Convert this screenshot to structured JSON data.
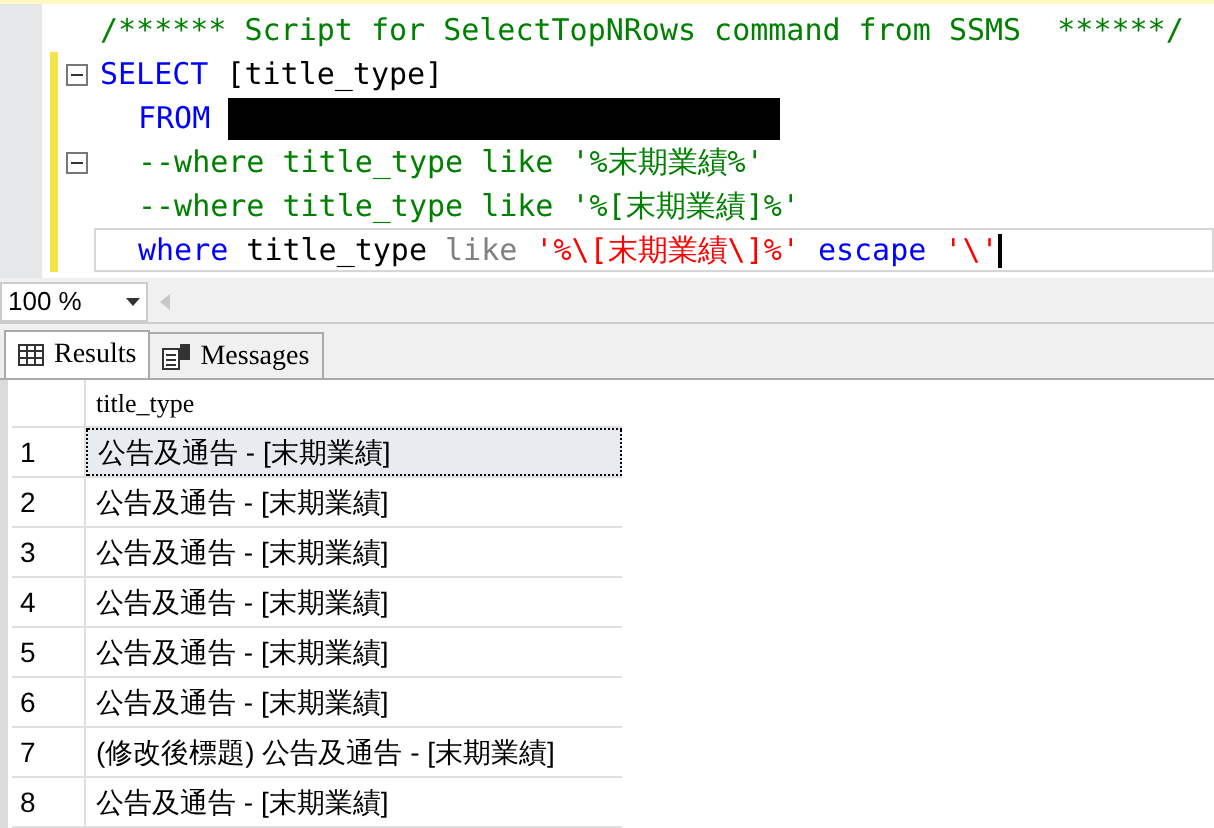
{
  "editor": {
    "lines": [
      {
        "indented": false,
        "foldable": false,
        "current": false,
        "tokens": [
          {
            "kind": "comment",
            "text": "/****** Script for SelectTopNRows command from SSMS  ******/"
          }
        ]
      },
      {
        "indented": false,
        "foldable": true,
        "current": false,
        "tokens": [
          {
            "kind": "keyword",
            "text": "SELECT"
          },
          {
            "kind": "plain",
            "text": " [title_type]"
          }
        ]
      },
      {
        "indented": true,
        "foldable": false,
        "current": false,
        "tokens": [
          {
            "kind": "keyword",
            "text": "FROM"
          },
          {
            "kind": "redacted"
          }
        ]
      },
      {
        "indented": true,
        "foldable": true,
        "current": false,
        "tokens": [
          {
            "kind": "comment",
            "text": "--where title_type like '%末期業績%'"
          }
        ]
      },
      {
        "indented": true,
        "foldable": false,
        "current": false,
        "tokens": [
          {
            "kind": "comment",
            "text": "--where title_type like '%[末期業績]%'"
          }
        ]
      },
      {
        "indented": true,
        "foldable": false,
        "current": true,
        "tokens": [
          {
            "kind": "keyword",
            "text": "where"
          },
          {
            "kind": "plain",
            "text": " title_type "
          },
          {
            "kind": "operator",
            "text": "like"
          },
          {
            "kind": "string",
            "text": " '%\\[末期業績\\]%'"
          },
          {
            "kind": "keyword",
            "text": " escape"
          },
          {
            "kind": "string",
            "text": " '\\'"
          }
        ]
      }
    ]
  },
  "zoom": {
    "value": "100 %"
  },
  "tabs": [
    {
      "label": "Results",
      "kind": "grid",
      "selected": true
    },
    {
      "label": "Messages",
      "kind": "messages",
      "selected": false
    }
  ],
  "results": {
    "columns": [
      "title_type"
    ],
    "rows": [
      {
        "number": "1",
        "cells": [
          "公告及通告 - [末期業績]"
        ],
        "selected": true
      },
      {
        "number": "2",
        "cells": [
          "公告及通告 - [末期業績]"
        ],
        "selected": false
      },
      {
        "number": "3",
        "cells": [
          "公告及通告 - [末期業績]"
        ],
        "selected": false
      },
      {
        "number": "4",
        "cells": [
          "公告及通告 - [末期業績]"
        ],
        "selected": false
      },
      {
        "number": "5",
        "cells": [
          "公告及通告 - [末期業績]"
        ],
        "selected": false
      },
      {
        "number": "6",
        "cells": [
          "公告及通告 - [末期業績]"
        ],
        "selected": false
      },
      {
        "number": "7",
        "cells": [
          "(修改後標題) 公告及通告 - [末期業績]"
        ],
        "selected": false
      },
      {
        "number": "8",
        "cells": [
          "公告及通告 - [末期業績]"
        ],
        "selected": false
      }
    ]
  }
}
